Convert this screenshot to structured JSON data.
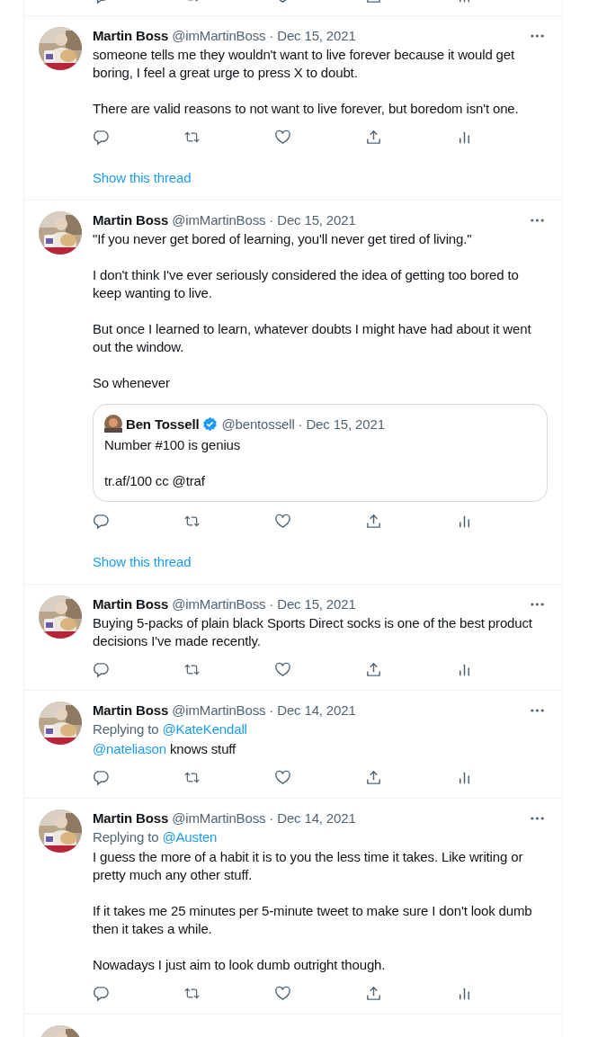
{
  "tweets": [
    {
      "kind": "full",
      "name": "Martin Boss",
      "handle": "@imMartinBoss",
      "dot": "·",
      "date": "Dec 15, 2021",
      "paragraphs": [
        [
          {
            "text": "someone tells me they wouldn't want to live forever because it would get boring, I feel a great urge to press X to doubt.",
            "link": false
          }
        ],
        [
          {
            "text": "There are valid reasons to not want to live forever, but boredom isn't one.",
            "link": false
          }
        ]
      ],
      "show_thread": "Show this thread"
    },
    {
      "kind": "full",
      "name": "Martin Boss",
      "handle": "@imMartinBoss",
      "dot": "·",
      "date": "Dec 15, 2021",
      "paragraphs": [
        [
          {
            "text": "\"If you never get bored of learning, you'll never get tired of living.\"",
            "link": false
          }
        ],
        [
          {
            "text": "I don't think I've ever seriously considered the idea of getting too bored to keep wanting to live.",
            "link": false
          }
        ],
        [
          {
            "text": "But once I learned to learn, whatever doubts I might have had about it went out the window.",
            "link": false
          }
        ],
        [
          {
            "text": "So whenever",
            "link": false
          }
        ]
      ],
      "quote": {
        "name": "Ben Tossell",
        "verified": true,
        "handle": "@bentossell",
        "dot": "·",
        "date": "Dec 15, 2021",
        "paragraphs": [
          "Number #100 is genius",
          "tr.af/100 cc @traf"
        ]
      },
      "show_thread": "Show this thread"
    },
    {
      "kind": "full",
      "name": "Martin Boss",
      "handle": "@imMartinBoss",
      "dot": "·",
      "date": "Dec 15, 2021",
      "paragraphs": [
        [
          {
            "text": "Buying 5-packs of plain black Sports Direct socks is one of the best product decisions I've made recently.",
            "link": false
          }
        ]
      ]
    },
    {
      "kind": "full",
      "name": "Martin Boss",
      "handle": "@imMartinBoss",
      "dot": "·",
      "date": "Dec 14, 2021",
      "replying_label": "Replying to",
      "replying_to": "@KateKendall",
      "paragraphs": [
        [
          {
            "text": "@nateliason",
            "link": true
          },
          {
            "text": " knows stuff",
            "link": false
          }
        ]
      ]
    },
    {
      "kind": "full",
      "name": "Martin Boss",
      "handle": "@imMartinBoss",
      "dot": "·",
      "date": "Dec 14, 2021",
      "replying_label": "Replying to",
      "replying_to": "@Austen",
      "paragraphs": [
        [
          {
            "text": "I guess the more of a habit it is to you the less time it takes. Like writing or pretty much any other stuff.",
            "link": false
          }
        ],
        [
          {
            "text": "If it takes me 25 minutes per 5-minute tweet to make sure I don't look dumb then it takes a while.",
            "link": false
          }
        ],
        [
          {
            "text": "Nowadays I just aim to look dumb outright though.",
            "link": false
          }
        ]
      ]
    },
    {
      "kind": "cut"
    }
  ]
}
